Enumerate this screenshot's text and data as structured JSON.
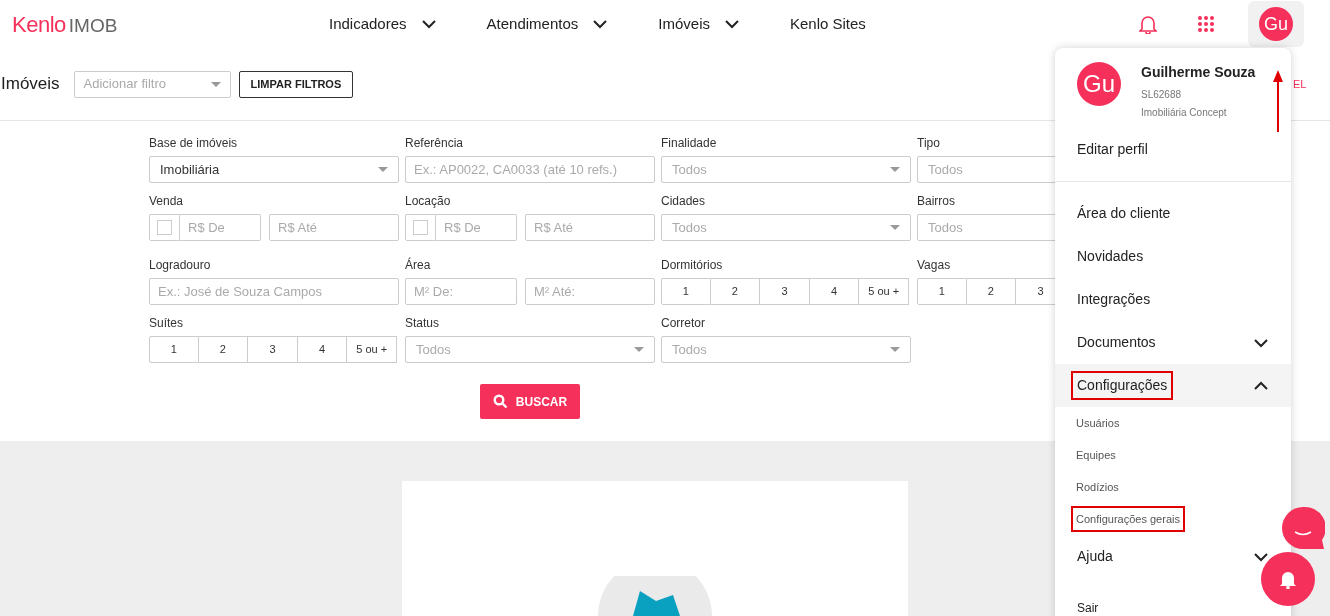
{
  "header": {
    "logo": {
      "brand": "Kenlo",
      "product": "IMOB"
    },
    "nav": [
      {
        "label": "Indicadores",
        "has_dropdown": true
      },
      {
        "label": "Atendimentos",
        "has_dropdown": true
      },
      {
        "label": "Imóveis",
        "has_dropdown": true
      },
      {
        "label": "Kenlo Sites",
        "has_dropdown": false
      }
    ],
    "avatar_initials": "Gu"
  },
  "toolbar": {
    "title": "Imóveis",
    "filter_placeholder": "Adicionar filtro",
    "clear_button": "LIMPAR FILTROS",
    "partial_text": "EL"
  },
  "filters": [
    [
      {
        "kind": "select",
        "label": "Base de imóveis",
        "value": "Imobiliária"
      },
      {
        "kind": "text",
        "label": "Referência",
        "placeholder": "Ex.: AP0022, CA0033 (até 10 refs.)"
      },
      {
        "kind": "select",
        "label": "Finalidade",
        "placeholder": "Todos"
      },
      {
        "kind": "select",
        "label": "Tipo",
        "placeholder": "Todos"
      }
    ],
    [
      {
        "kind": "range",
        "label": "Venda",
        "checked": false,
        "from_placeholder": "R$ De",
        "to_placeholder": "R$ Até"
      },
      {
        "kind": "range",
        "label": "Locação",
        "checked": false,
        "from_placeholder": "R$ De",
        "to_placeholder": "R$ Até"
      },
      {
        "kind": "select",
        "label": "Cidades",
        "placeholder": "Todos"
      },
      {
        "kind": "select",
        "label": "Bairros",
        "placeholder": "Todos"
      }
    ],
    [
      {
        "kind": "text",
        "label": "Logradouro",
        "placeholder": "Ex.: José de Souza Campos"
      },
      {
        "kind": "pair",
        "label": "Área",
        "from_placeholder": "M² De:",
        "to_placeholder": "M² Até:"
      },
      {
        "kind": "segmented",
        "label": "Dormitórios",
        "options": [
          "1",
          "2",
          "3",
          "4",
          "5 ou +"
        ]
      },
      {
        "kind": "segmented",
        "label": "Vagas",
        "options": [
          "1",
          "2",
          "3"
        ]
      }
    ],
    [
      {
        "kind": "segmented",
        "label": "Suítes",
        "options": [
          "1",
          "2",
          "3",
          "4",
          "5 ou +"
        ]
      },
      {
        "kind": "select",
        "label": "Status",
        "placeholder": "Todos"
      },
      {
        "kind": "select",
        "label": "Corretor",
        "placeholder": "Todos"
      }
    ]
  ],
  "search_button": "BUSCAR",
  "user_menu": {
    "avatar_initials": "Gu",
    "name": "Guilherme Souza",
    "code": "SL62688",
    "company": "Imobiliária Concept",
    "items": [
      {
        "kind": "item",
        "label": "Editar perfil",
        "highlighted": false
      },
      {
        "kind": "divider"
      },
      {
        "kind": "item",
        "label": "Área do cliente",
        "highlighted": false
      },
      {
        "kind": "item",
        "label": "Novidades",
        "highlighted": false
      },
      {
        "kind": "item",
        "label": "Integrações",
        "highlighted": false
      },
      {
        "kind": "expandable",
        "label": "Documentos",
        "expanded": false,
        "highlighted": false
      },
      {
        "kind": "expandable",
        "label": "Configurações",
        "expanded": true,
        "highlighted": true
      },
      {
        "kind": "subitem",
        "label": "Usuários",
        "highlighted": false
      },
      {
        "kind": "subitem",
        "label": "Equipes",
        "highlighted": false
      },
      {
        "kind": "subitem",
        "label": "Rodízios",
        "highlighted": false
      },
      {
        "kind": "subitem",
        "label": "Configurações gerais",
        "highlighted": true
      },
      {
        "kind": "expandable",
        "label": "Ajuda",
        "expanded": false,
        "highlighted": false
      },
      {
        "kind": "logout",
        "label": "Sair",
        "highlighted": false
      }
    ]
  }
}
